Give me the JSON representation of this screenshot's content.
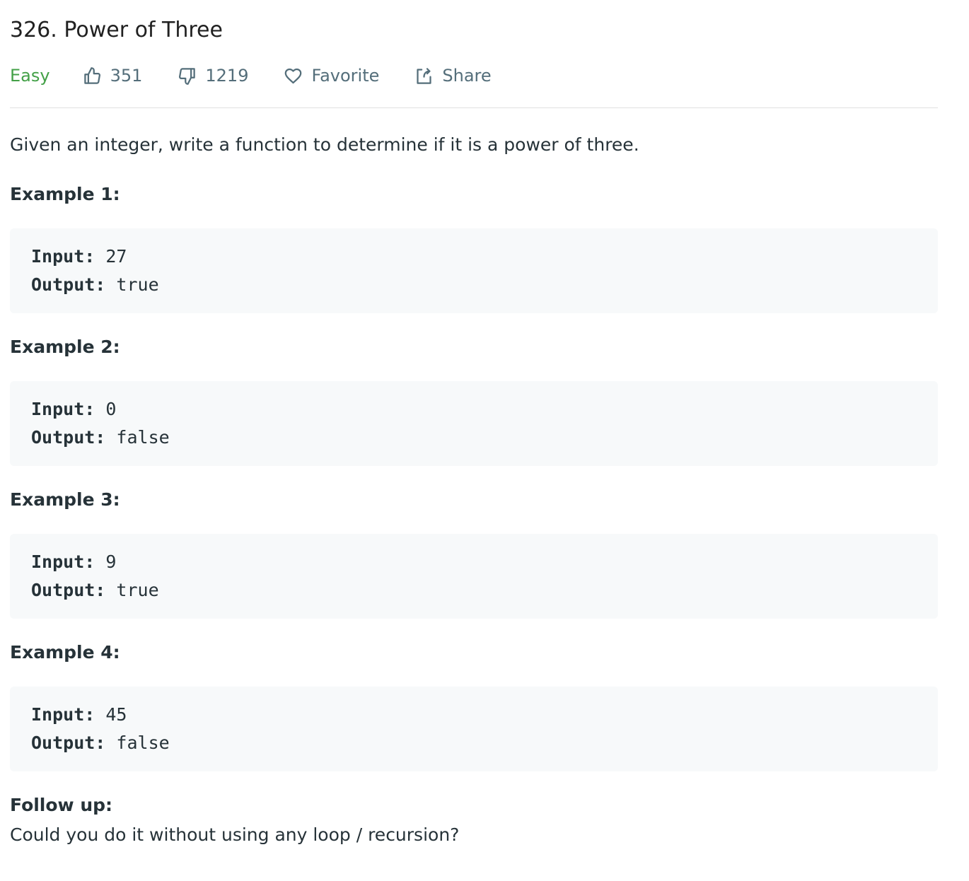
{
  "problem": {
    "title": "326. Power of Three",
    "difficulty": "Easy",
    "likes": "351",
    "dislikes": "1219",
    "favorite_label": "Favorite",
    "share_label": "Share",
    "description": "Given an integer, write a function to determine if it is a power of three."
  },
  "examples": [
    {
      "heading": "Example 1:",
      "input_label": "Input:",
      "input": "27",
      "output_label": "Output:",
      "output": "true"
    },
    {
      "heading": "Example 2:",
      "input_label": "Input:",
      "input": "0",
      "output_label": "Output:",
      "output": "false"
    },
    {
      "heading": "Example 3:",
      "input_label": "Input:",
      "input": "9",
      "output_label": "Output:",
      "output": "true"
    },
    {
      "heading": "Example 4:",
      "input_label": "Input:",
      "input": "45",
      "output_label": "Output:",
      "output": "false"
    }
  ],
  "followup": {
    "heading": "Follow up:",
    "text": "Could you do it without using any loop / recursion?"
  },
  "colors": {
    "easy": "#43a047",
    "code_background": "#f7f9fa",
    "meta_text": "#546e7a"
  }
}
